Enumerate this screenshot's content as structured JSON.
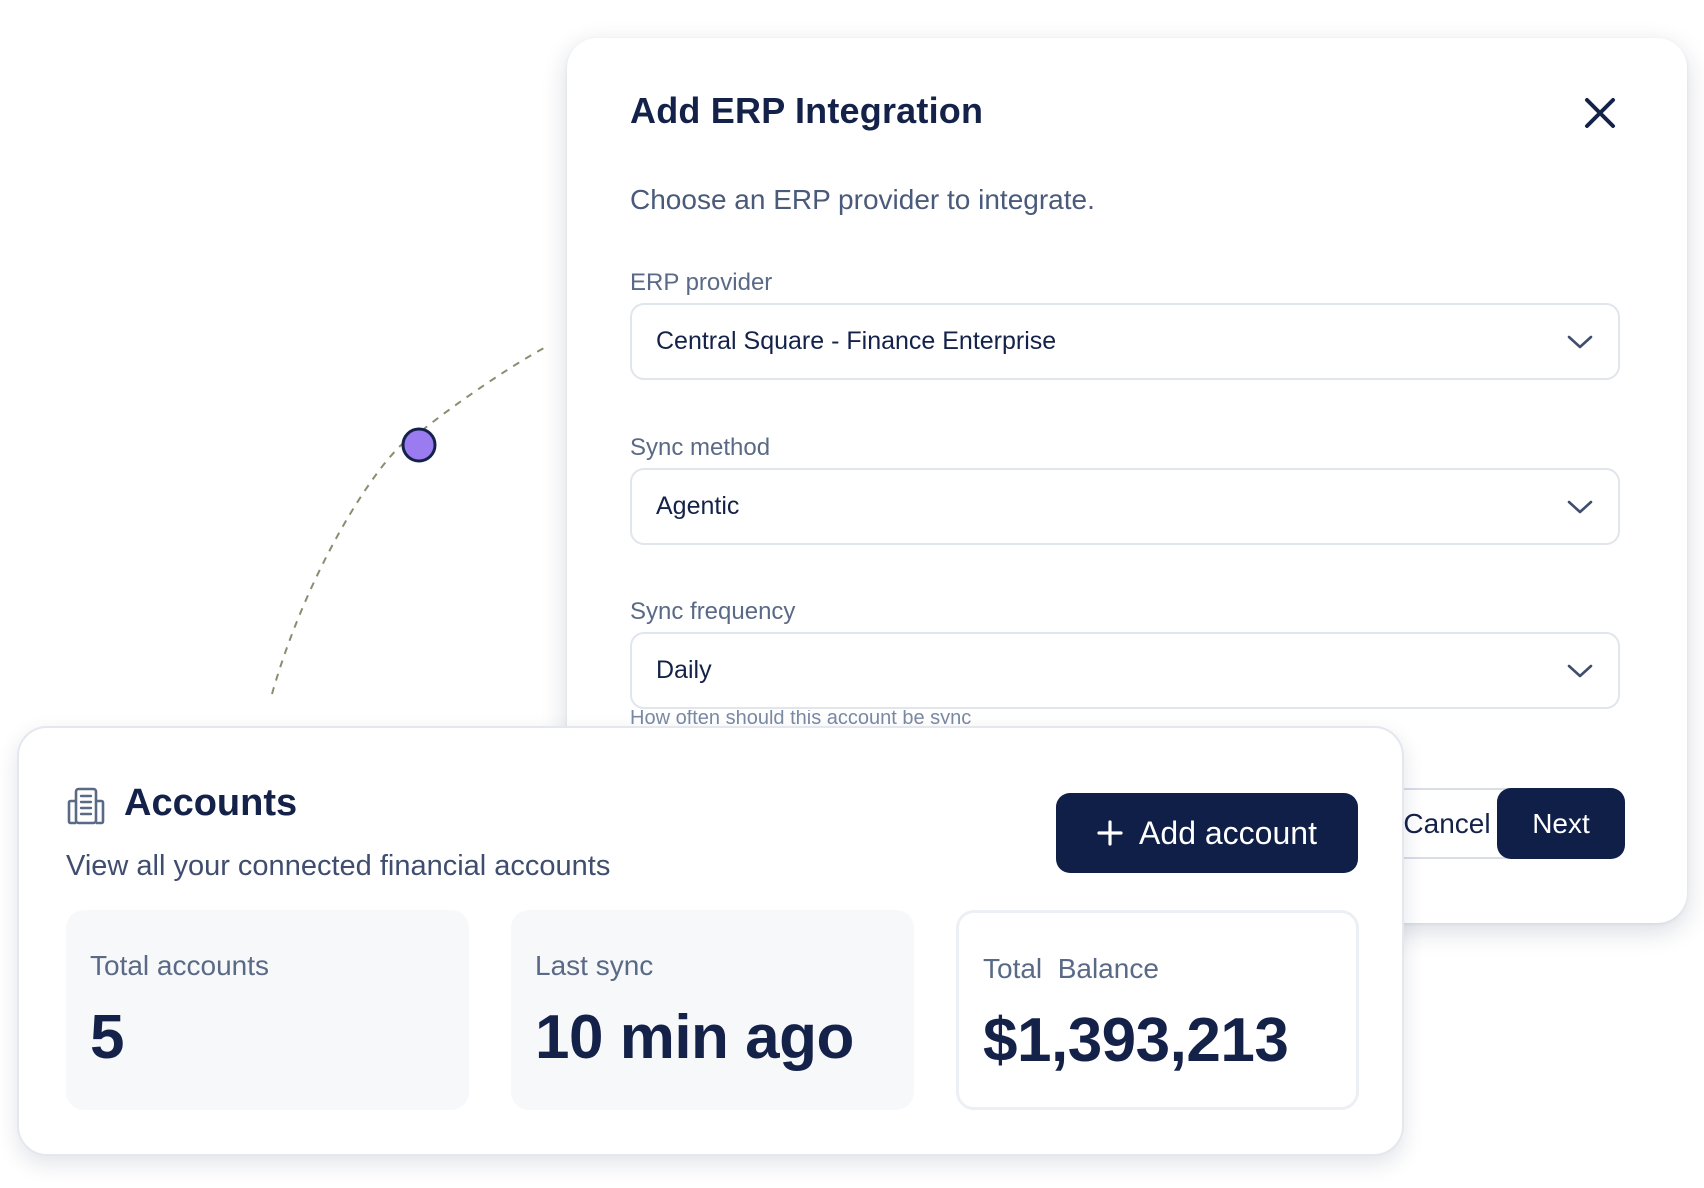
{
  "modal": {
    "title": "Add ERP Integration",
    "subtitle": "Choose an ERP provider to integrate.",
    "fields": [
      {
        "label": "ERP provider",
        "value": "Central Square - Finance Enterprise"
      },
      {
        "label": "Sync method",
        "value": "Agentic"
      },
      {
        "label": "Sync frequency",
        "value": "Daily"
      }
    ],
    "helper_text": "How often should this account be sync",
    "cancel_label": "Cancel",
    "next_label": "Next",
    "icons": {
      "close": "close-icon",
      "chevron": "chevron-down-icon"
    }
  },
  "accounts": {
    "title": "Accounts",
    "subtitle": "View all your connected financial accounts",
    "add_button_label": "Add account",
    "icons": {
      "header": "building-icon",
      "add": "plus-icon"
    },
    "stats": [
      {
        "label": "Total accounts",
        "value": "5"
      },
      {
        "label": "Last sync",
        "value": "10 min ago"
      },
      {
        "label": "Total  Balance",
        "value": "$1,393,213"
      }
    ]
  },
  "colors": {
    "primary": "#0f1f48",
    "text": "#14224a",
    "muted": "#5a6a86",
    "dot": "#9b7cf0",
    "connector": "#8c8c6e"
  }
}
